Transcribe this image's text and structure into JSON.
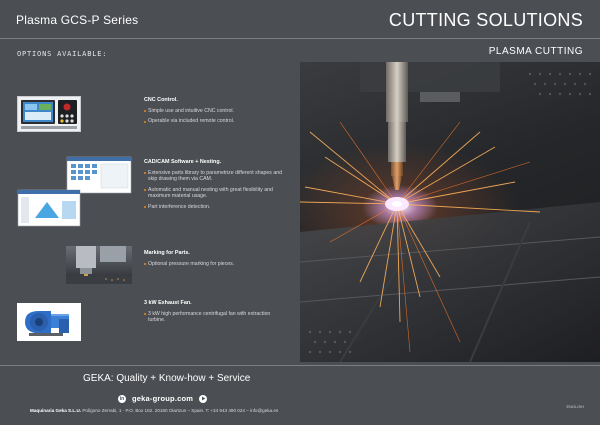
{
  "header": {
    "series": "Plasma GCS-P Series",
    "brand": "CUTTING SOLUTIONS",
    "subtitle": "PLASMA CUTTING",
    "options_label": "OPTIONS AVAILABLE:"
  },
  "options": [
    {
      "title": "CNC Control.",
      "icon": "cnc-control-panel-image",
      "items": [
        "Simple use and intuitive CNC control.",
        "Operable via included remote control."
      ]
    },
    {
      "title": "CAD/CAM Software + Nesting.",
      "icon": "cad-cam-software-screens-image",
      "items": [
        "Extensive parts library to parametrize different shapes and skip drawing them via CAM.",
        "Automatic and manual nesting with great flexibility and maximum material usage.",
        "Part interference detection."
      ]
    },
    {
      "title": "Marking for Parts.",
      "icon": "marking-tool-image",
      "items": [
        "Optional pressure marking for pieces."
      ]
    },
    {
      "title": "3 kW Exhaust Fan.",
      "icon": "exhaust-fan-image",
      "items": [
        "3 kW high performance centrifugal fan with extraction turbine."
      ]
    }
  ],
  "footer": {
    "quality": "GEKA: Quality + Know-how + Service",
    "website": "geka-group.com",
    "linkedin_glyph": "in",
    "address_company": "Maquinaria Geka S.L.U.",
    "address_rest": " Polígono Zerrabi, 1 · P.O. Box 162. 20180 Oiartzun – Spain.   T: +34 943 490 024 – info@geka.es",
    "language": "ENGLISH"
  },
  "colors": {
    "background": "#4b4e53",
    "accent": "#f08a1a",
    "rule": "#7a7d82"
  }
}
